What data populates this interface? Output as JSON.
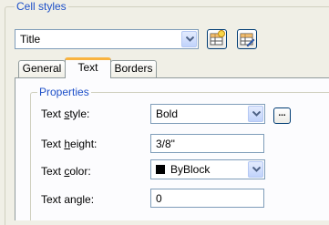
{
  "cell_styles": {
    "group_label": "Cell styles",
    "selected_style": "Title"
  },
  "tabs": [
    {
      "label": "General"
    },
    {
      "label": "Text"
    },
    {
      "label": "Borders"
    }
  ],
  "properties": {
    "group_label": "Properties",
    "text_style": {
      "label_pre": "Text ",
      "label_ul": "s",
      "label_post": "tyle:",
      "value": "Bold"
    },
    "text_height": {
      "label_pre": "Text ",
      "label_ul": "h",
      "label_post": "eight:",
      "value": "3/8\""
    },
    "text_color": {
      "label_pre": "Text ",
      "label_ul": "c",
      "label_post": "olor:",
      "value": "ByBlock",
      "swatch_color": "#000000"
    },
    "text_angle": {
      "label_pre": "Text an",
      "label_ul": "g",
      "label_post": "le:",
      "value": "0"
    },
    "ellipsis_label": "..."
  },
  "colors": {
    "accent_legend": "#1e50c8",
    "active_tab_highlight": "#f9b33f"
  }
}
